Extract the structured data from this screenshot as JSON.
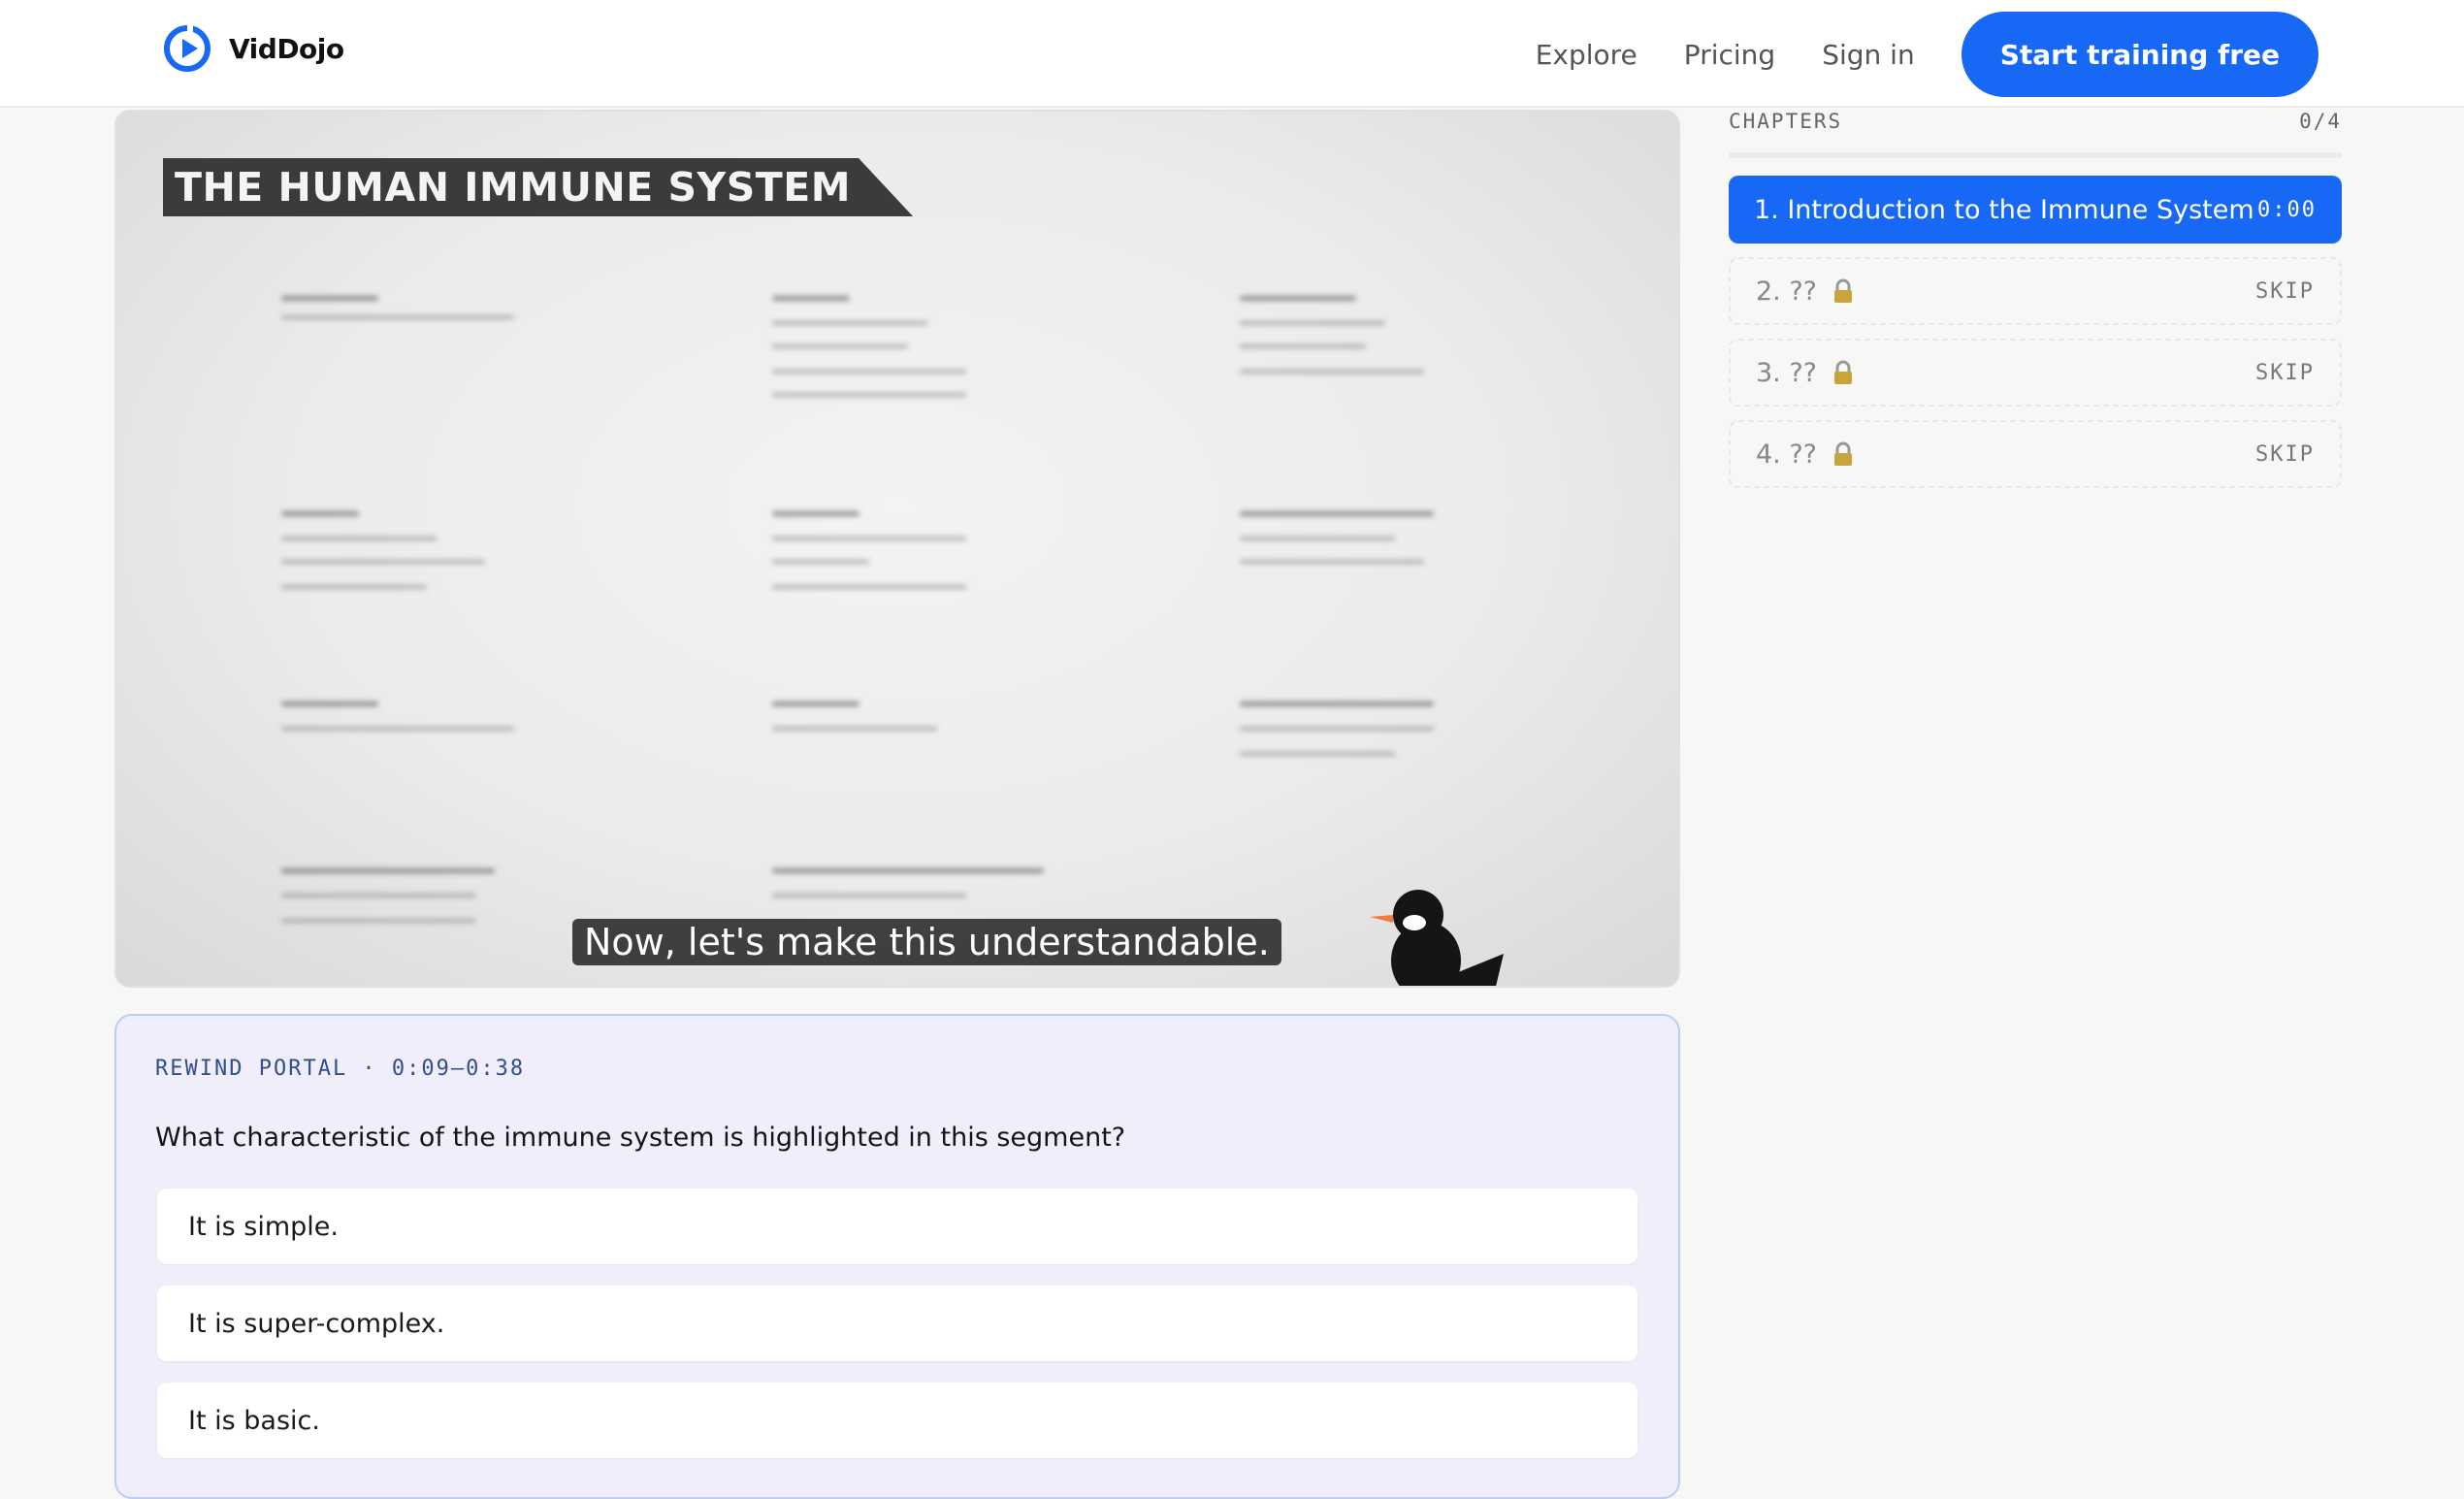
{
  "brand": {
    "name": "VidDojo",
    "logo_icon": "play-circle-icon",
    "accent": "#1769f5"
  },
  "nav": {
    "explore": "Explore",
    "pricing": "Pricing",
    "sign_in": "Sign in",
    "cta": "Start training free"
  },
  "video": {
    "banner": "THE HUMAN IMMUNE SYSTEM",
    "caption": "Now, let's make this understandable."
  },
  "portal": {
    "label": "REWIND PORTAL · 0:09–0:38",
    "question": "What characteristic of the immune system is highlighted in this segment?",
    "options": [
      "It is simple.",
      "It is super-complex.",
      "It is basic."
    ]
  },
  "chapters": {
    "heading": "CHAPTERS",
    "count": "0/4",
    "items": [
      {
        "title": "1. Introduction to the Immune System",
        "meta": "0:00"
      },
      {
        "title": "2. ??",
        "meta": "SKIP"
      },
      {
        "title": "3. ??",
        "meta": "SKIP"
      },
      {
        "title": "4. ??",
        "meta": "SKIP"
      }
    ]
  }
}
